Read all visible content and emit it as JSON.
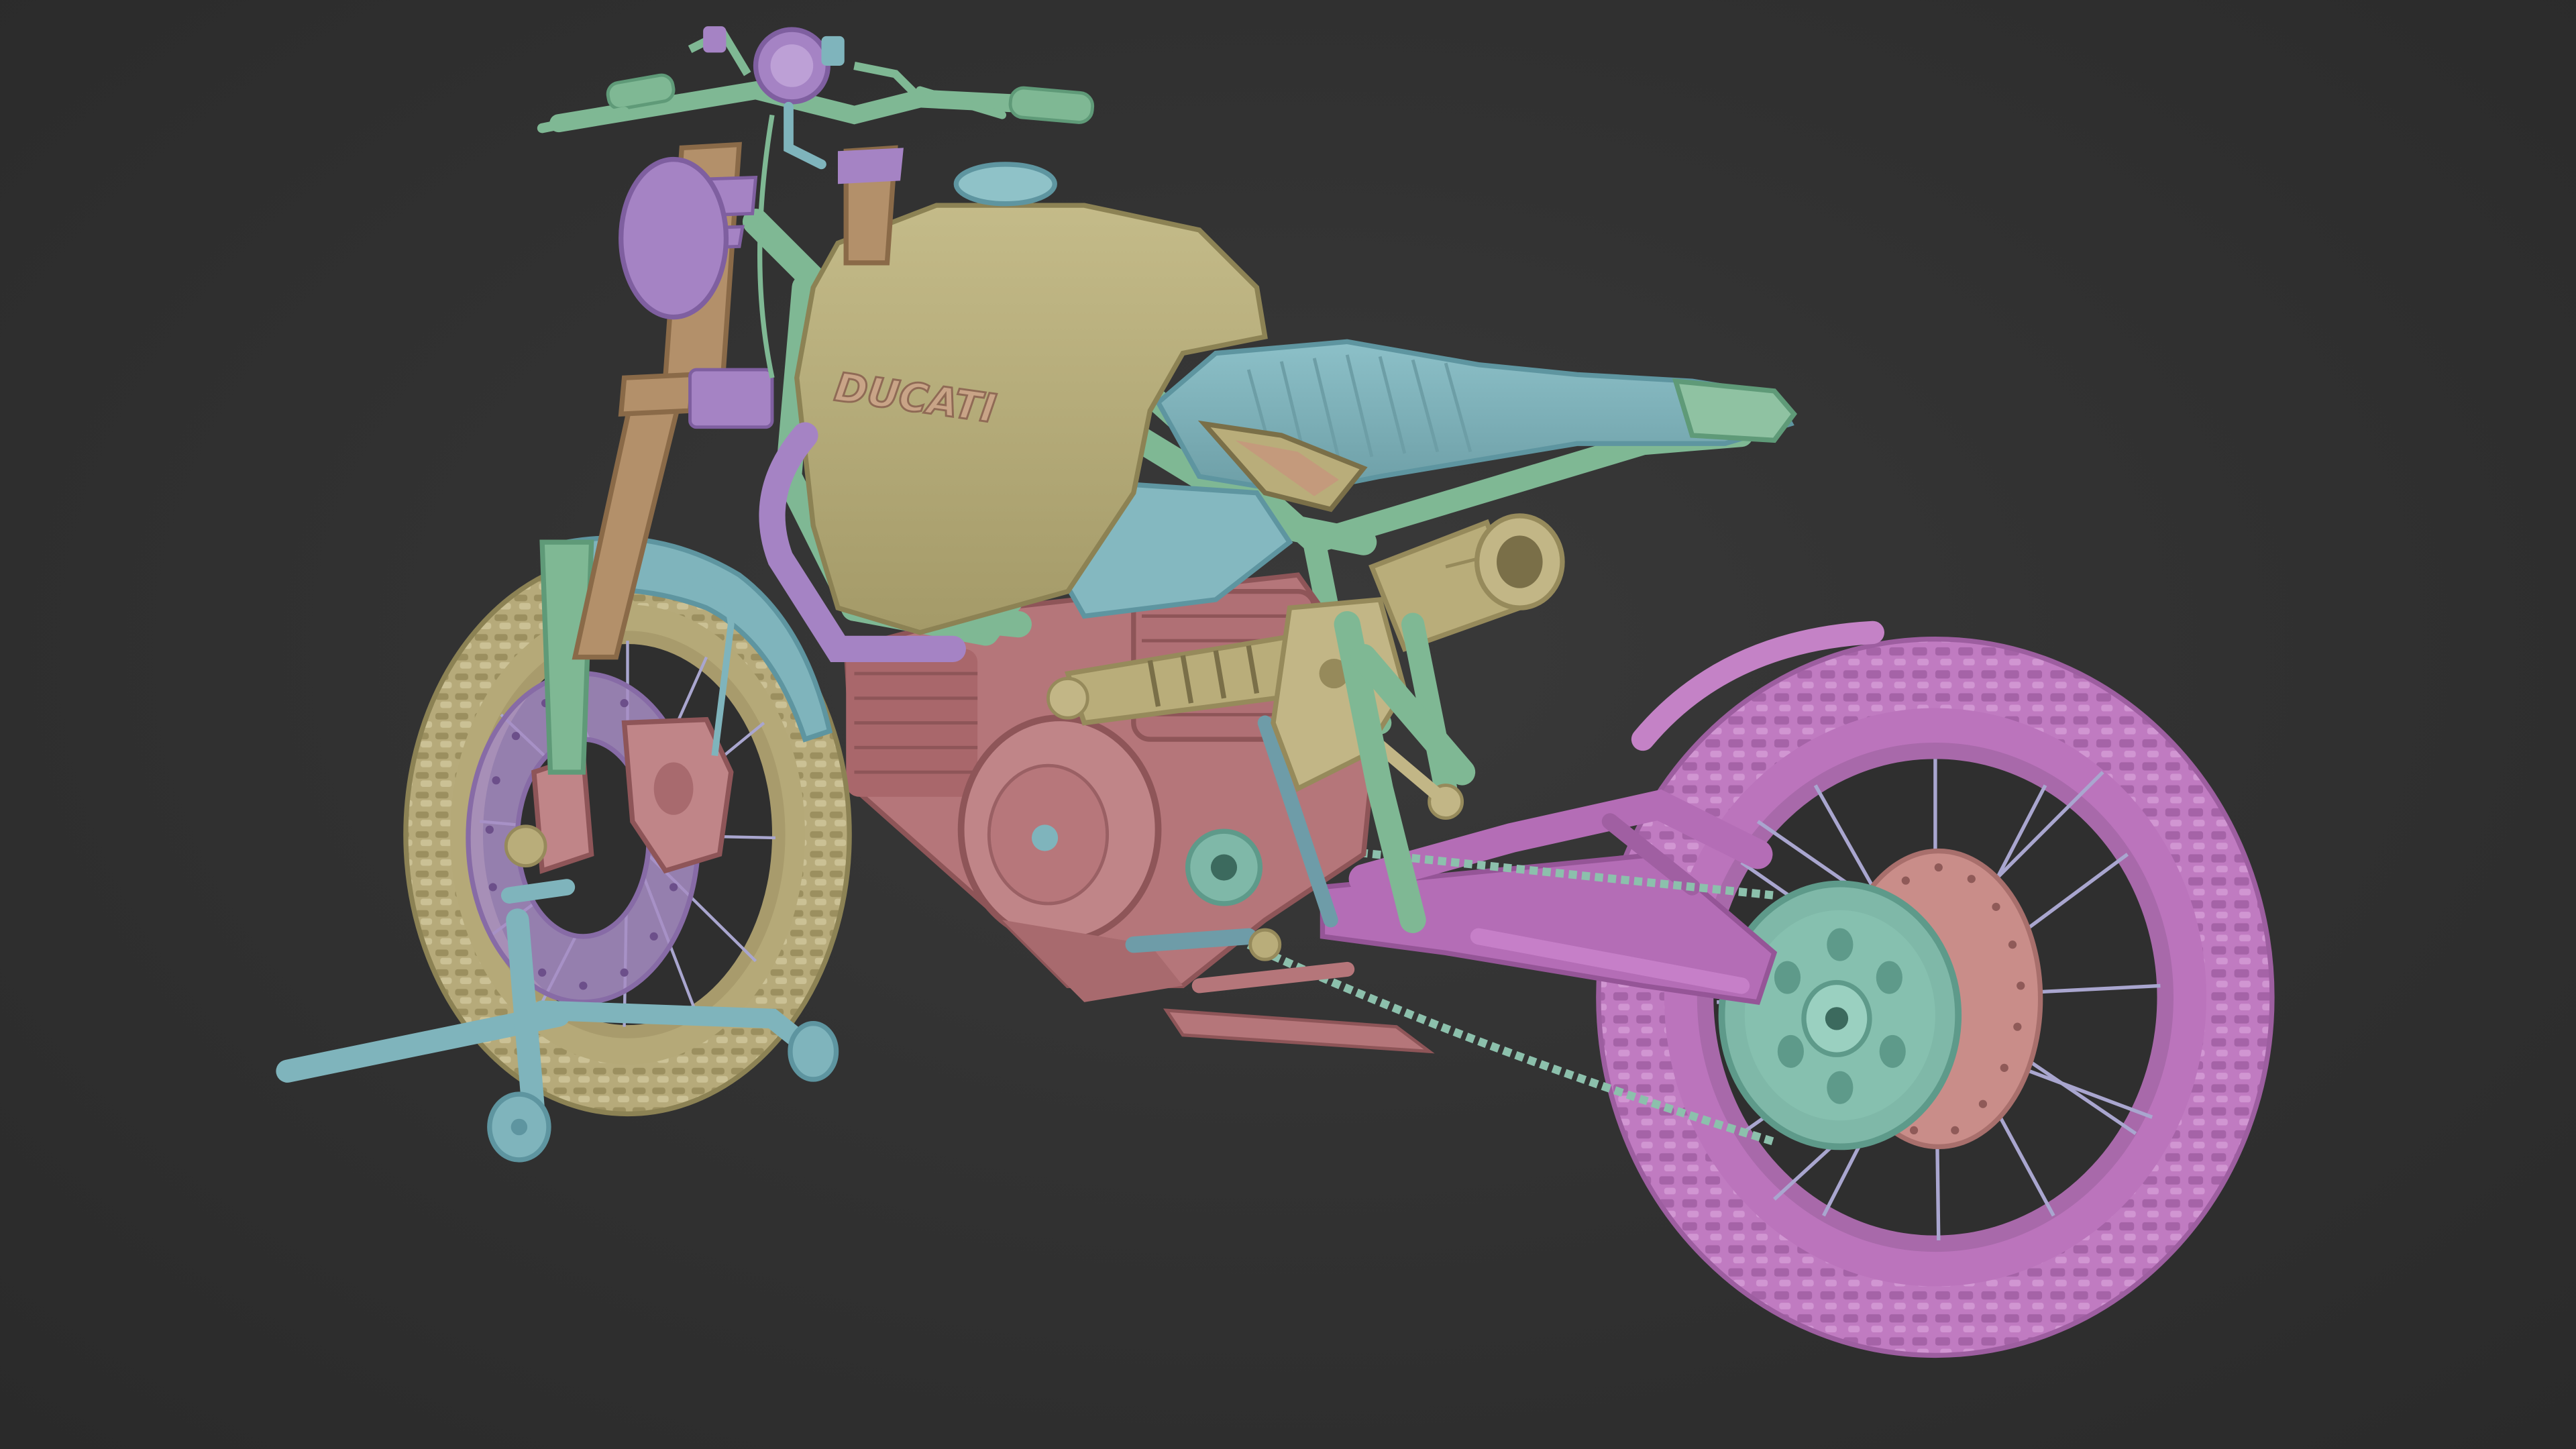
{
  "scene": {
    "subject": "motorcycle-3d-model",
    "tank_logo_text": "DUCATI",
    "colors": {
      "background": "#2e2e2e",
      "tan": "#b8ad7c",
      "tan_dark": "#9c9160",
      "green": "#7fb894",
      "green_dark": "#5f9a78",
      "blue": "#7fb4bc",
      "blue_dark": "#5e95a0",
      "pink": "#c27fc2",
      "pink_dark": "#a365a6",
      "purple": "#a583c4",
      "rose": "#b8787c",
      "rose_dark": "#9a5f62",
      "tan_fork": "#b3906a",
      "spoke": "#a9a6cf"
    }
  }
}
